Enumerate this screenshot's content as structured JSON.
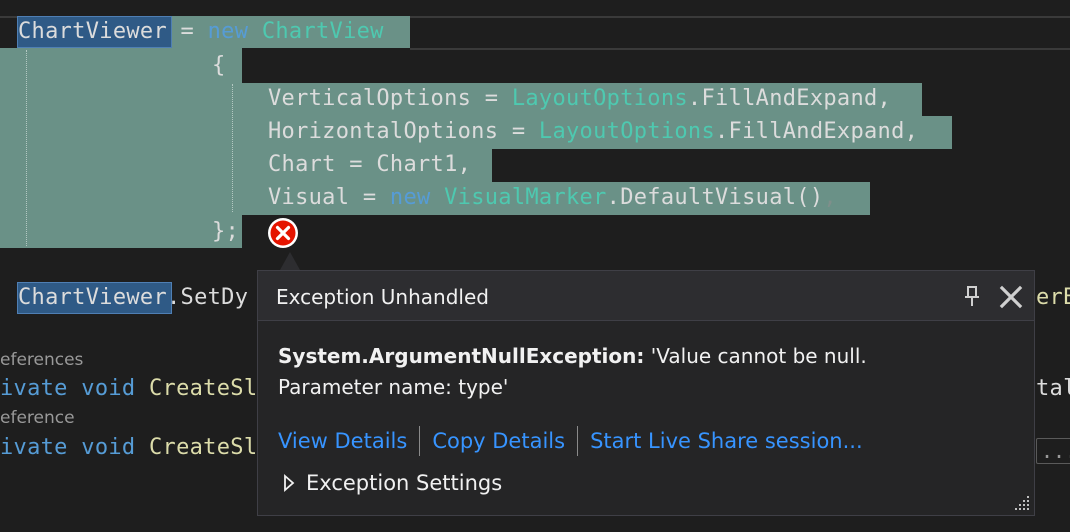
{
  "code": {
    "line1": {
      "var": "ChartViewer",
      "mid": " = ",
      "kw_new": "new",
      "type": " ChartView"
    },
    "line2": "{",
    "line3": {
      "prop": "VerticalOptions",
      "eq": " = ",
      "enum": "LayoutOptions",
      "rest": ".FillAndExpand,"
    },
    "line4": {
      "prop": "HorizontalOptions",
      "eq": " = ",
      "enum": "LayoutOptions",
      "rest": ".FillAndExpand,"
    },
    "line5": {
      "prop": "Chart",
      "eq": " = ",
      "val": "Chart1,"
    },
    "line6": {
      "prop": "Visual",
      "eq": " = ",
      "kw_new": "new",
      "type": " VisualMarker",
      "rest": ".DefaultVisual()",
      "comma": ","
    },
    "line7": "};",
    "line8": {
      "var": "ChartViewer",
      "rest": ".SetDy",
      "tail": "erB"
    },
    "lens1": "eferences",
    "line9": {
      "kw": "ivate void",
      "method": " CreateSl",
      "tail": "tal"
    },
    "lens2": "eference",
    "line10": {
      "kw": "ivate void",
      "method": " CreateSl",
      "tail": "..."
    }
  },
  "popup": {
    "title": "Exception Unhandled",
    "exception_type": "System.ArgumentNullException:",
    "exception_message": " 'Value cannot be null.",
    "exception_message_2": "Parameter name: type'",
    "links": {
      "view_details": "View Details",
      "copy_details": "Copy Details",
      "live_share": "Start Live Share session..."
    },
    "settings_label": "Exception Settings"
  },
  "colors": {
    "selection": "#6a9187",
    "keyword": "#569cd6",
    "type": "#4ec9b0",
    "link": "#3794ff",
    "error": "#e51400"
  }
}
